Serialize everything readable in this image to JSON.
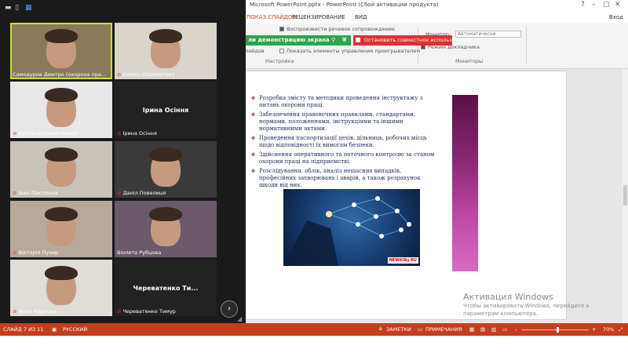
{
  "powerpoint": {
    "title": "Microsoft PowerPoint.pptx - PowerPoint (Сбой активации продукта)",
    "tabs": [
      {
        "label": "ПОКАЗ СЛАЙДОВ"
      },
      {
        "label": "РЕЦЕНЗИРОВАНИЕ"
      },
      {
        "label": "ВИД"
      }
    ],
    "user": "Вход",
    "ribbon": {
      "record_audio": "Воспроизвести речевое сопровождение",
      "left_cut": "ли демонстрацию экрана",
      "left_cut2": "лайдов",
      "group_setup": "Настройка",
      "show_controls": "Показать элементы управления проигрывателем",
      "monitor_label": "Монитор:",
      "monitor_value": "Автоматически",
      "presenter_view": "Режим докладчика",
      "group_monitors": "Мониторы"
    },
    "share_bar": "ли демонстрацию экрана",
    "stop_share": "Остановить совместное использование",
    "slide": {
      "bullets": [
        "Розробка змісту та методики проведення інструктажу з питань охорони праці.",
        "Забезпечення правовочних правилами, стандартами, нормами, положеннями, інструкціями та іншими нормативними актами.",
        "Проведення паспортизації цехів, дільниць, робочих місць щодо відповідності їх вимогам безпеки.",
        "Здійснення оперативного та поточного контролю за станом охорони праці на підприємстві.",
        "Розслідування, облік, аналіз нещасних випадків, професійних захворювань і аварій, а також розрахунок шкоди від них."
      ],
      "image_watermark": "NEWKIBy.RU"
    },
    "activation": {
      "title": "Активация Windows",
      "line1": "Чтобы активировать Windows, перейдите к",
      "line2": "параметрам компьютера."
    },
    "status": {
      "slide_info": "СЛАЙД 7 ИЗ 11",
      "language": "РУССКИЙ",
      "notes": "ЗАМЕТКИ",
      "comments": "ПРИМЕЧАНИЯ",
      "zoom": "70%",
      "zoom_percent": 70
    }
  },
  "zoom": {
    "participants": [
      {
        "name": "Самодуров Дмитро (охорона пра...",
        "video": true,
        "muted": false,
        "active": true,
        "bg": "#8a7a5a"
      },
      {
        "name": "Олена Шароватова",
        "video": true,
        "muted": true,
        "active": false,
        "bg": "#d9d4cc"
      },
      {
        "name": "Руслан Кромчатенков",
        "video": true,
        "muted": true,
        "active": false,
        "bg": "#e8e8e8"
      },
      {
        "name": "Ірина Осіння",
        "video": false,
        "muted": true,
        "active": false,
        "display": "Ірина Осіння"
      },
      {
        "name": "Іван Лактіонов",
        "video": true,
        "muted": true,
        "active": false,
        "bg": "#c9c2b8"
      },
      {
        "name": "Даніл Повелиця",
        "video": true,
        "muted": true,
        "active": false,
        "bg": "#3a3a3a"
      },
      {
        "name": "Вікторія Пухир",
        "video": true,
        "muted": true,
        "active": false,
        "bg": "#b8a89a"
      },
      {
        "name": "Віолета Рубцова",
        "video": true,
        "muted": false,
        "active": false,
        "bg": "#6a5a6a"
      },
      {
        "name": "Анна Маркова",
        "video": true,
        "muted": true,
        "active": false,
        "bg": "#e0dcd8"
      },
      {
        "name": "Череватенко Тимур",
        "video": false,
        "muted": true,
        "active": false,
        "display": "Череватенко  Ти..."
      }
    ]
  }
}
